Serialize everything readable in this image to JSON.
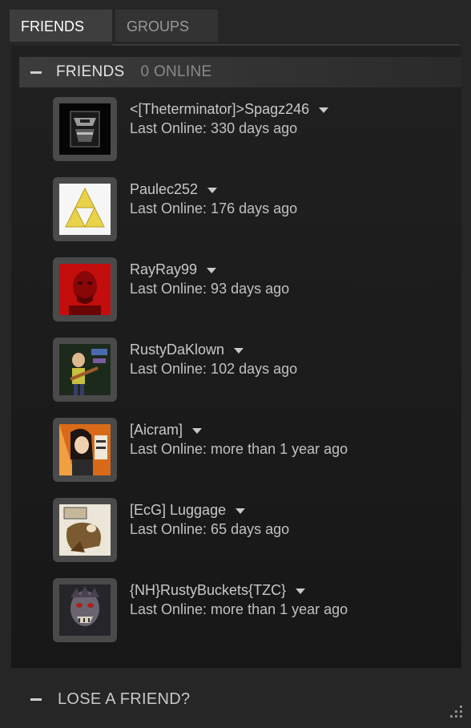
{
  "tabs": [
    {
      "label": "FRIENDS",
      "active": true
    },
    {
      "label": "GROUPS",
      "active": false
    }
  ],
  "group": {
    "title": "FRIENDS",
    "count": "0 ONLINE"
  },
  "friends": [
    {
      "name": "<[Theterminator]>Spagz246",
      "status": "Last Online: 330 days ago",
      "avatar_icon": "dark-clan-logo"
    },
    {
      "name": "Paulec252",
      "status": "Last Online: 176 days ago",
      "avatar_icon": "triforce"
    },
    {
      "name": "RayRay99",
      "status": "Last Online: 93 days ago",
      "avatar_icon": "red-face"
    },
    {
      "name": "RustyDaKlown",
      "status": "Last Online: 102 days ago",
      "avatar_icon": "cartoon-guitarist"
    },
    {
      "name": "[Aicram]",
      "status": "Last Online: more than 1 year ago",
      "avatar_icon": "cartoon-girl"
    },
    {
      "name": "[EcG] Luggage",
      "status": "Last Online: 65 days ago",
      "avatar_icon": "cartoon-creature"
    },
    {
      "name": "{NH}RustyBuckets{TZC}",
      "status": "Last Online: more than 1 year ago",
      "avatar_icon": "zombie-face"
    }
  ],
  "footer": {
    "label": "LOSE A FRIEND?"
  },
  "colors": {
    "background": "#262626",
    "panel": "#1b1b1b",
    "text": "#c8c8c8",
    "muted": "#8a8a8a"
  }
}
